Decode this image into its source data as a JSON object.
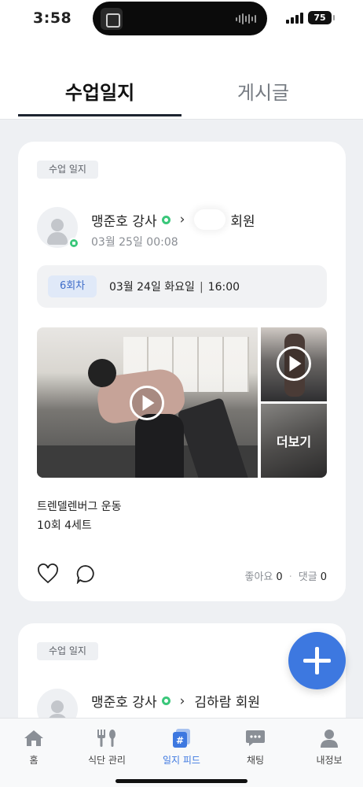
{
  "status_bar": {
    "time": "3:58",
    "battery": "75"
  },
  "tabs": {
    "active": "수업일지",
    "inactive": "게시글"
  },
  "posts": [
    {
      "chip": "수업 일지",
      "instructor": "맹준호 강사",
      "member_name": "회원",
      "date": "03월 25일 00:08",
      "session_badge": "6회차",
      "session_date": "03월 24일 화요일",
      "session_time": "16:00",
      "more_label": "더보기",
      "exercise_name": "트렌델렌버그 운동",
      "exercise_detail": "10회 4세트",
      "likes_label": "좋아요",
      "likes_count": "0",
      "comments_label": "댓글",
      "comments_count": "0"
    },
    {
      "chip": "수업 일지",
      "instructor": "맹준호 강사",
      "member_name": "김하람 회원"
    }
  ],
  "bottom_nav": [
    {
      "label": "홈",
      "icon": "home-icon"
    },
    {
      "label": "식단 관리",
      "icon": "utensils-icon"
    },
    {
      "label": "일지 피드",
      "icon": "feed-icon"
    },
    {
      "label": "채팅",
      "icon": "chat-icon"
    },
    {
      "label": "내정보",
      "icon": "profile-icon"
    }
  ],
  "colors": {
    "accent": "#3d78e0",
    "online": "#3ac77a",
    "badge_bg": "#e0e9f8"
  }
}
